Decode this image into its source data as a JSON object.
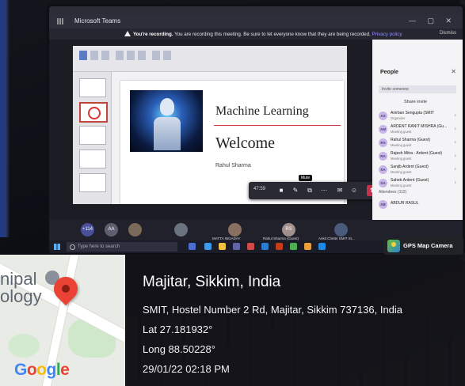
{
  "teams": {
    "app_title": "Microsoft Teams",
    "recording_notice_bold": "You're recording.",
    "recording_notice_text": "You are recording this meeting. Be sure to let everyone know that they are being recorded.",
    "privacy_link": "Privacy policy",
    "dismiss_label": "Dismiss",
    "slide": {
      "title": "Machine Learning",
      "subtitle": "Welcome",
      "presenter": "Rahul Sharma"
    },
    "call_controls": {
      "timer": "47:59",
      "mute_tooltip": "Mute"
    },
    "people": {
      "header": "People",
      "invite_placeholder": "Invite someone",
      "share_invite": "Share invite",
      "participants": [
        {
          "initials": "AS",
          "name": "Anirban Sengupta (SMIT",
          "role": "Organizer"
        },
        {
          "initials": "AM",
          "name": "ARDENT RANIT MISHRA (Gu...",
          "role": "Meeting guest"
        },
        {
          "initials": "RS",
          "name": "Rahul Sharma (Guest)",
          "role": "Meeting guest"
        },
        {
          "initials": "RA",
          "name": "Rajesh Mitra - Ardent (Guest)",
          "role": "Meeting guest"
        },
        {
          "initials": "SA",
          "name": "Sanjib Ardent (Guest)",
          "role": "Meeting guest"
        },
        {
          "initials": "SA",
          "name": "Saheb Ardent (Guest)",
          "role": "Meeting guest"
        }
      ],
      "attendees_label": "Attendees (112)",
      "last_row": {
        "initials": "AB",
        "name": "ABDUR RASUL"
      }
    },
    "gallery": {
      "overflow_count": "+114",
      "tiles": [
        {
          "initials": "AA"
        },
        {
          "initials": "RS",
          "name": "Rahul Sharma (Guest)"
        }
      ],
      "names": [
        "MATTA INGADAY",
        "Rahul Sharma (Guest)",
        "Ankit Chettri SMIT St..."
      ]
    },
    "taskbar": {
      "search_placeholder": "Type here to search"
    }
  },
  "gps_camera": {
    "badge_label": "GPS Map Camera",
    "location_title": "Majitar, Sikkim, India",
    "address": "SMIT, Hostel Number 2 Rd, Majitar, Sikkim 737136, India",
    "latitude": "Lat 27.181932°",
    "longitude": "Long 88.50228°",
    "datetime": "29/01/22 02:18 PM",
    "map_campus_label": "nipal\nology",
    "google_logo": [
      "G",
      "o",
      "o",
      "g",
      "l",
      "e"
    ]
  }
}
